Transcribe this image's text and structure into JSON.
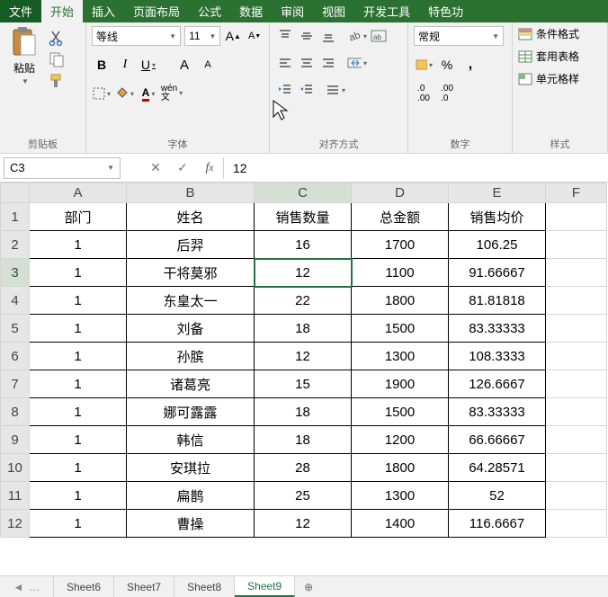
{
  "menu": {
    "file": "文件",
    "home": "开始",
    "insert": "插入",
    "layout": "页面布局",
    "formula": "公式",
    "data": "数据",
    "review": "审阅",
    "view": "视图",
    "dev": "开发工具",
    "special": "特色功"
  },
  "ribbon": {
    "clipboard": {
      "label": "剪贴板",
      "paste": "粘贴"
    },
    "font": {
      "label": "字体",
      "name": "等线",
      "size": "11"
    },
    "alignment": {
      "label": "对齐方式"
    },
    "number": {
      "label": "数字",
      "format": "常规"
    },
    "styles": {
      "label": "样式",
      "cond": "条件格式",
      "table": "套用表格",
      "cell": "单元格样"
    }
  },
  "namebox": "C3",
  "formula_value": "12",
  "chart_data": {
    "type": "table",
    "headers": [
      "部门",
      "姓名",
      "销售数量",
      "总金额",
      "销售均价"
    ],
    "rows": [
      [
        "1",
        "后羿",
        "16",
        "1700",
        "106.25"
      ],
      [
        "1",
        "干将莫邪",
        "12",
        "1100",
        "91.66667"
      ],
      [
        "1",
        "东皇太一",
        "22",
        "1800",
        "81.81818"
      ],
      [
        "1",
        "刘备",
        "18",
        "1500",
        "83.33333"
      ],
      [
        "1",
        "孙膑",
        "12",
        "1300",
        "108.3333"
      ],
      [
        "1",
        "诸葛亮",
        "15",
        "1900",
        "126.6667"
      ],
      [
        "1",
        "娜可露露",
        "18",
        "1500",
        "83.33333"
      ],
      [
        "1",
        "韩信",
        "18",
        "1200",
        "66.66667"
      ],
      [
        "1",
        "安琪拉",
        "28",
        "1800",
        "64.28571"
      ],
      [
        "1",
        "扁鹊",
        "25",
        "1300",
        "52"
      ],
      [
        "1",
        "曹操",
        "12",
        "1400",
        "116.6667"
      ]
    ]
  },
  "columns": [
    "A",
    "B",
    "C",
    "D",
    "E",
    "F"
  ],
  "sheets": {
    "tabs": [
      "Sheet6",
      "Sheet7",
      "Sheet8",
      "Sheet9"
    ],
    "active": "Sheet9",
    "more": "…"
  },
  "selected_cell": {
    "row": 3,
    "col": "C"
  }
}
